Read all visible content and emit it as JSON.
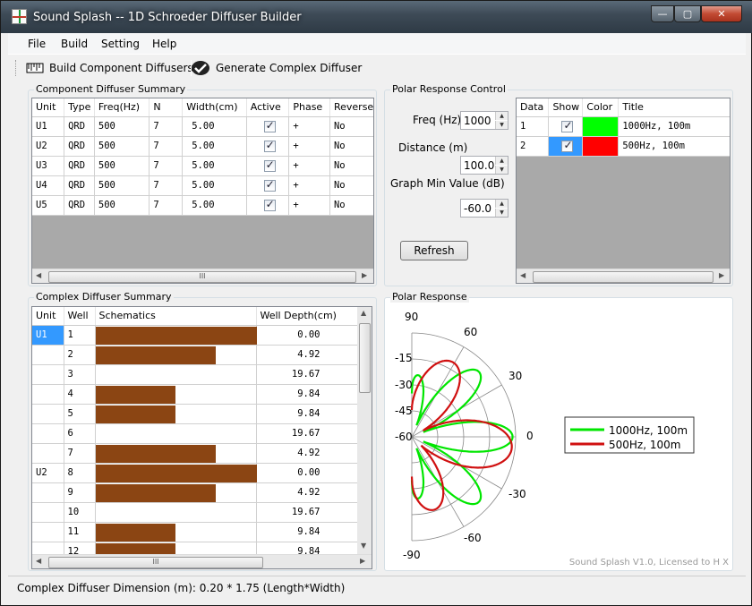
{
  "window": {
    "title": "Sound Splash -- 1D Schroeder Diffuser Builder",
    "min": "—",
    "max": "▢",
    "close": "✕"
  },
  "menu": [
    "File",
    "Build",
    "Setting",
    "Help"
  ],
  "toolbar": {
    "build_label": "Build Component Diffusers",
    "generate_label": "Generate Complex Diffuser"
  },
  "component_summary": {
    "title": "Component Diffuser Summary",
    "columns": [
      "Unit",
      "Type",
      "Freq(Hz)",
      "N",
      "Width(cm)",
      "Active",
      "Phase",
      "Reverse"
    ],
    "rows": [
      {
        "unit": "U1",
        "type": "QRD",
        "freq": "500",
        "n": "7",
        "width": "5.00",
        "active": true,
        "phase": "+",
        "reverse": "No"
      },
      {
        "unit": "U2",
        "type": "QRD",
        "freq": "500",
        "n": "7",
        "width": "5.00",
        "active": true,
        "phase": "+",
        "reverse": "No"
      },
      {
        "unit": "U3",
        "type": "QRD",
        "freq": "500",
        "n": "7",
        "width": "5.00",
        "active": true,
        "phase": "+",
        "reverse": "No"
      },
      {
        "unit": "U4",
        "type": "QRD",
        "freq": "500",
        "n": "7",
        "width": "5.00",
        "active": true,
        "phase": "+",
        "reverse": "No"
      },
      {
        "unit": "U5",
        "type": "QRD",
        "freq": "500",
        "n": "7",
        "width": "5.00",
        "active": true,
        "phase": "+",
        "reverse": "No"
      }
    ]
  },
  "polar_control": {
    "title": "Polar Response Control",
    "freq_label": "Freq (Hz)",
    "freq_value": "1000",
    "distance_label": "Distance (m)",
    "distance_value": "100.0",
    "min_label": "Graph Min Value (dB)",
    "min_value": "-60.0",
    "refresh_label": "Refresh",
    "series_columns": [
      "Data",
      "Show",
      "Color",
      "Title"
    ],
    "series": [
      {
        "data": "1",
        "show": true,
        "color": "#00ff00",
        "title": "1000Hz, 100m"
      },
      {
        "data": "2",
        "show": true,
        "color": "#ff0000",
        "title": "500Hz, 100m"
      }
    ]
  },
  "complex_summary": {
    "title": "Complex Diffuser Summary",
    "columns": [
      "Unit",
      "Well",
      "Schematics",
      "Well Depth(cm)"
    ],
    "max_depth": 19.67,
    "rows": [
      {
        "unit": "U1",
        "well": "1",
        "depth": 0.0,
        "depth_text": "0.00"
      },
      {
        "unit": "",
        "well": "2",
        "depth": 4.92,
        "depth_text": "4.92"
      },
      {
        "unit": "",
        "well": "3",
        "depth": 19.67,
        "depth_text": "19.67"
      },
      {
        "unit": "",
        "well": "4",
        "depth": 9.84,
        "depth_text": "9.84"
      },
      {
        "unit": "",
        "well": "5",
        "depth": 9.84,
        "depth_text": "9.84"
      },
      {
        "unit": "",
        "well": "6",
        "depth": 19.67,
        "depth_text": "19.67"
      },
      {
        "unit": "",
        "well": "7",
        "depth": 4.92,
        "depth_text": "4.92"
      },
      {
        "unit": "U2",
        "well": "8",
        "depth": 0.0,
        "depth_text": "0.00"
      },
      {
        "unit": "",
        "well": "9",
        "depth": 4.92,
        "depth_text": "4.92"
      },
      {
        "unit": "",
        "well": "10",
        "depth": 19.67,
        "depth_text": "19.67"
      },
      {
        "unit": "",
        "well": "11",
        "depth": 9.84,
        "depth_text": "9.84"
      },
      {
        "unit": "",
        "well": "12",
        "depth": 9.84,
        "depth_text": "9.84"
      }
    ]
  },
  "polar_response": {
    "title": "Polar Response",
    "angle_labels": [
      "90",
      "60",
      "30",
      "0",
      "-30",
      "-60",
      "-90"
    ],
    "db_labels": [
      "-15",
      "-30",
      "-45",
      "-60"
    ],
    "legend": [
      "1000Hz, 100m",
      "500Hz, 100m"
    ],
    "footer": "Sound Splash V1.0, Licensed to H X"
  },
  "status": "Complex Diffuser Dimension (m): 0.20 * 1.75 (Length*Width)"
}
